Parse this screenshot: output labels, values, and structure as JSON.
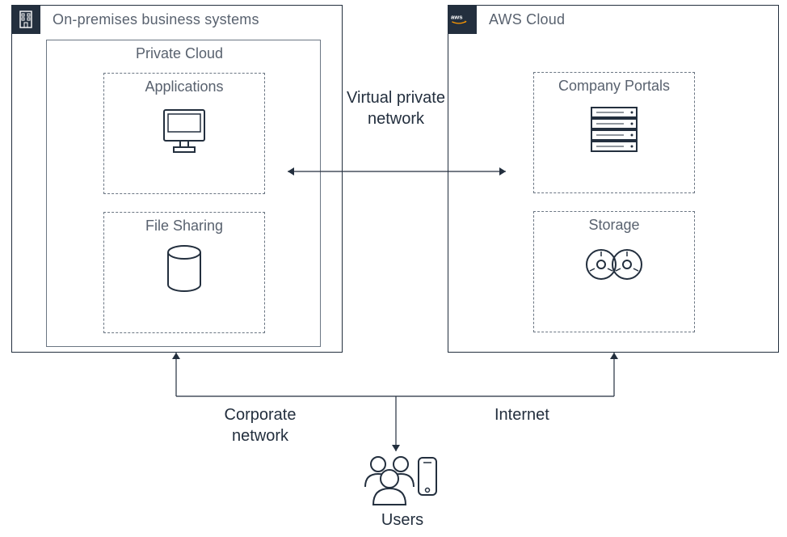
{
  "onprem": {
    "title": "On-premises business systems",
    "private_cloud": {
      "title": "Private Cloud",
      "applications": {
        "label": "Applications"
      },
      "file_sharing": {
        "label": "File Sharing"
      }
    }
  },
  "aws": {
    "title": "AWS Cloud",
    "company_portals": {
      "label": "Company Portals"
    },
    "storage": {
      "label": "Storage"
    }
  },
  "connections": {
    "vpn_label": "Virtual private network",
    "corporate_label": "Corporate network",
    "internet_label": "Internet"
  },
  "users": {
    "label": "Users"
  }
}
